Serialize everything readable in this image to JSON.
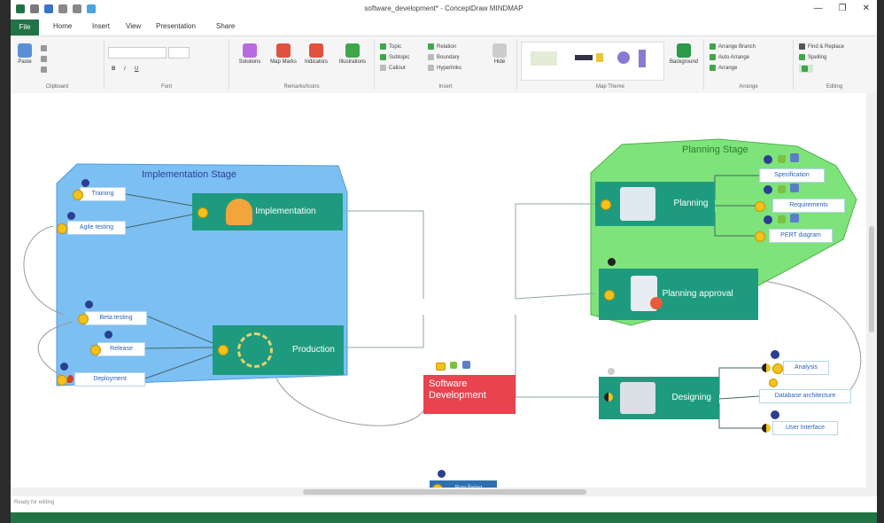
{
  "window": {
    "title": "software_development* - ConceptDraw MINDMAP",
    "controls": [
      "—",
      "❐",
      "✕"
    ]
  },
  "tabs": [
    "File",
    "Home",
    "Insert",
    "View",
    "Presentation",
    "Share"
  ],
  "ribbon": {
    "groups": [
      "Clipboard",
      "Font",
      "Remarks/Icons",
      "Insert",
      "Map Theme",
      "Arrange",
      "Editing"
    ],
    "buttons": {
      "paste": "Paste",
      "solutions": "Solutions",
      "map_marks": "Map Marks",
      "indicators": "Indicators",
      "illustrations": "Illustrations",
      "background": "Background",
      "hide": "Hide",
      "topic": "Topic",
      "callout": "Callout",
      "subtopic": "Subtopic",
      "relation": "Relation",
      "boundary": "Boundary",
      "hyperlinks": "Hyperlinks",
      "find_replace": "Find & Replace",
      "spelling": "Spelling",
      "arrange": "Arrange",
      "auto_arrange": "Auto Arrange",
      "arrange_mode": "Arrange Branch"
    }
  },
  "map": {
    "central": "Software Development",
    "implementation_boundary": "Implementation Stage",
    "planning_boundary": "Planning Stage",
    "implementation": "Implementation",
    "production": "Production",
    "planning": "Planning",
    "planning_approval": "Planning approval",
    "designing": "Designing",
    "bug_fixing": "Bug fixing",
    "impl_subs": [
      "Training",
      "Agile testing"
    ],
    "prod_subs": [
      "Beta testing",
      "Release",
      "Deployment"
    ],
    "plan_subs": [
      "Specification",
      "Requirements",
      "PERT diagram"
    ],
    "design_subs": [
      "Analysis",
      "Database architecture",
      "User Interface"
    ]
  },
  "status": {
    "left": "Ready for editing"
  },
  "colors": {
    "topic_green": "#1e9b7e",
    "central_red": "#e8434f",
    "impl_blue": "#7cbff3",
    "plan_green": "#7ee37a",
    "status_bar": "#217346"
  }
}
